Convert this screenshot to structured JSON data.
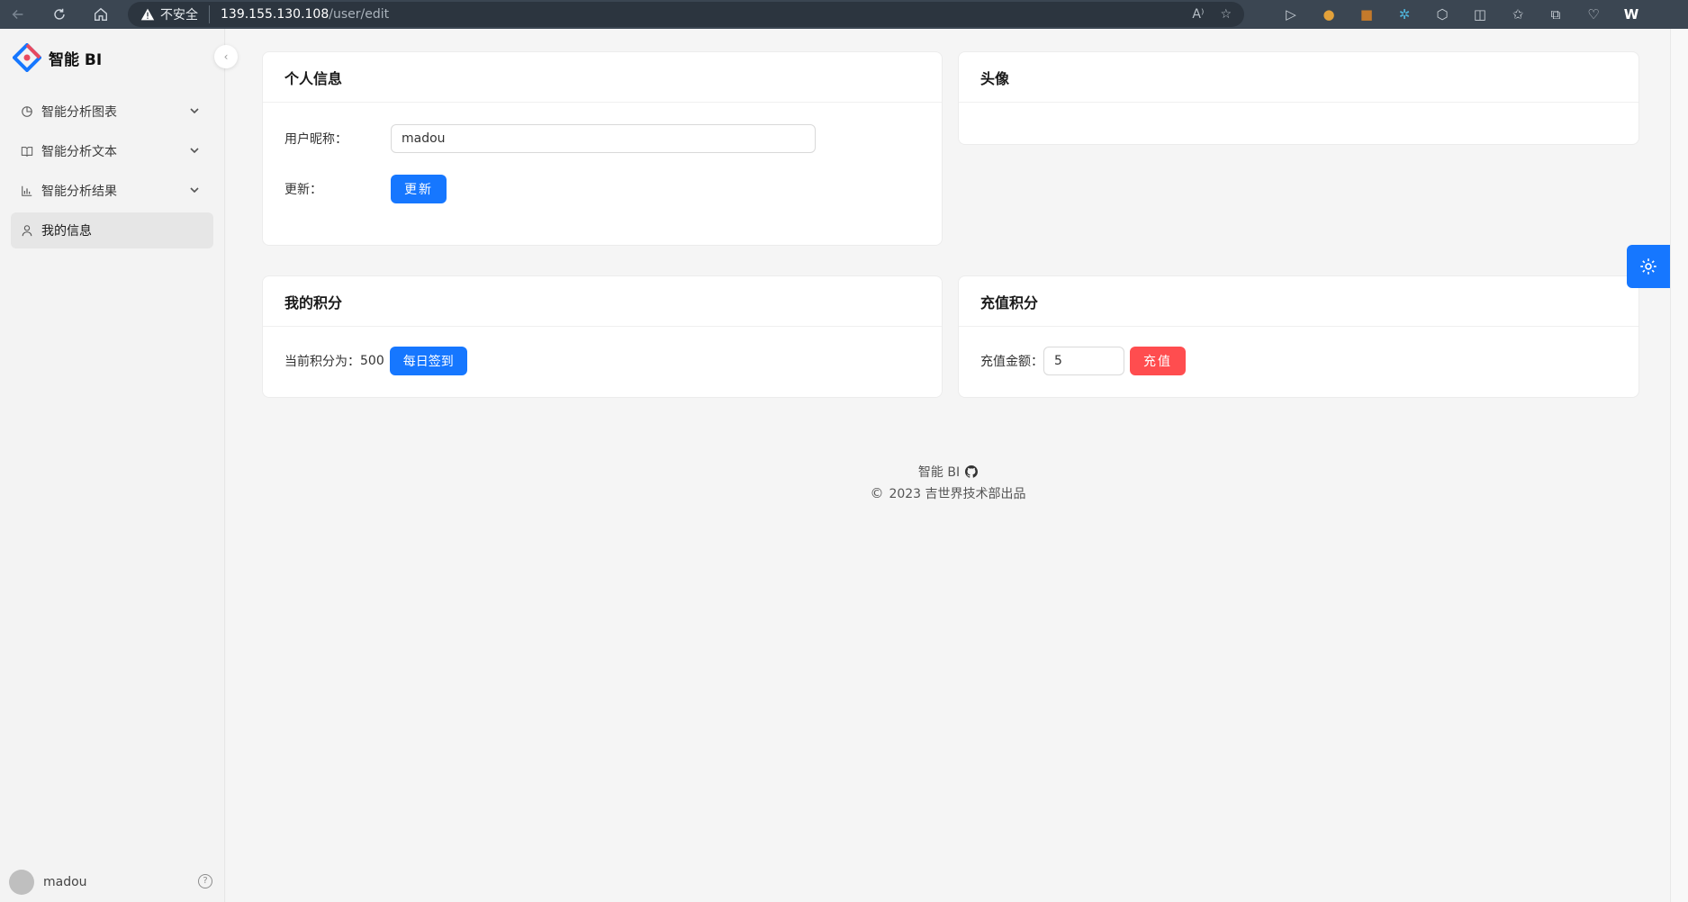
{
  "browser": {
    "security_label": "不安全",
    "url_host": "139.155.130.108",
    "url_path": "/user/edit"
  },
  "app": {
    "name": "智能 BI",
    "accent_color": "#1677ff",
    "danger_color": "#ff4d4f"
  },
  "sidebar": {
    "items": [
      {
        "label": "智能分析图表",
        "icon": "pie-chart-icon",
        "expandable": true
      },
      {
        "label": "智能分析文本",
        "icon": "book-icon",
        "expandable": true
      },
      {
        "label": "智能分析结果",
        "icon": "bar-chart-icon",
        "expandable": true
      },
      {
        "label": "我的信息",
        "icon": "user-icon",
        "active": true
      }
    ],
    "user_name": "madou"
  },
  "profile": {
    "title": "个人信息",
    "nickname_label": "用户昵称：",
    "nickname_value": "madou",
    "update_label": "更新：",
    "update_button": "更新"
  },
  "avatar_card": {
    "title": "头像"
  },
  "points": {
    "title": "我的积分",
    "current_label": "当前积分为：",
    "current_value": "500",
    "checkin_button": "每日签到"
  },
  "recharge": {
    "title": "充值积分",
    "amount_label": "充值金额：",
    "amount_value": "5",
    "recharge_button": "充值"
  },
  "footer": {
    "brand": "智能 BI",
    "copyright": "2023 吉世界技术部出品"
  }
}
